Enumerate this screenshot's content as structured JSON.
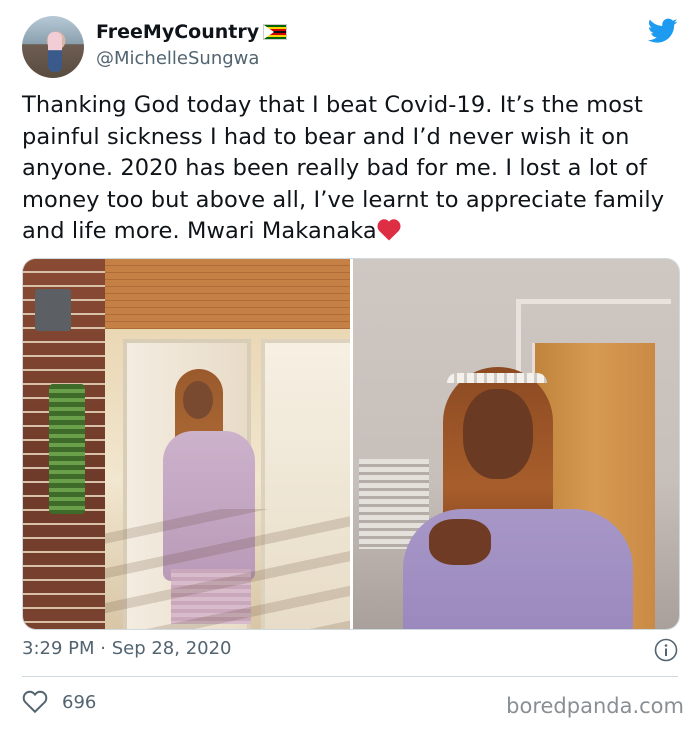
{
  "user": {
    "display_name": "FreeMyCountry",
    "handle": "@MichelleSungwa",
    "avatar_icon": "profile-photo",
    "flag_icon": "zimbabwe-flag"
  },
  "brand": {
    "icon": "twitter-bird-icon",
    "color": "#1d9bf0"
  },
  "tweet": {
    "text": "Thanking God today that I beat Covid-19. It’s the most painful sickness I had to bear and I’d never wish it on anyone. 2020 has been really bad for me. I lost a lot of money too but above all, I’ve learnt to appreciate family and life more. Mwari Makanaka",
    "emoji": "red-heart",
    "photos": [
      "photo-left",
      "photo-right"
    ],
    "timestamp": "3:29 PM · Sep 28, 2020",
    "like_count": "696"
  },
  "watermark": "boredpanda.com"
}
